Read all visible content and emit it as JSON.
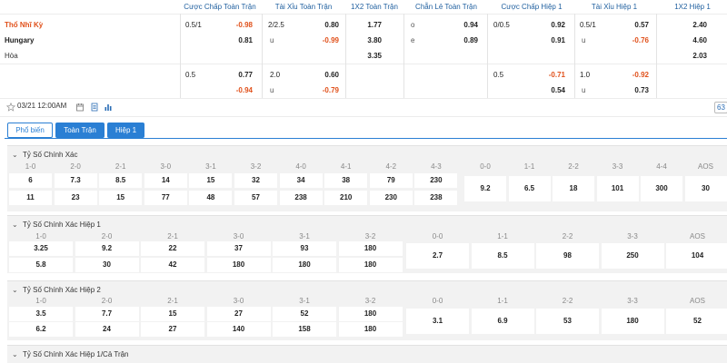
{
  "columns": [
    "Cược Chấp Toàn Trận",
    "Tài Xỉu Toàn Trận",
    "1X2 Toàn Trận",
    "Chẵn Lẻ Toàn Trận",
    "Cược Chấp Hiệp 1",
    "Tài Xỉu Hiệp 1",
    "1X2 Hiệp 1"
  ],
  "teams": {
    "home": "Thổ Nhĩ Kỳ",
    "away": "Hungary",
    "draw": "Hòa"
  },
  "row1": {
    "ah_line": "0.5/1",
    "ah_odd": "-0.98",
    "ou_line": "2/2.5",
    "ou_odd": "0.80",
    "x12": "1.77",
    "oe_label": "o",
    "oe_odd": "0.94",
    "h1_ah_line": "0/0.5",
    "h1_ah_odd": "0.92",
    "h1_ou_line": "0.5/1",
    "h1_ou_odd": "0.57",
    "h1_x12": "2.40"
  },
  "row2": {
    "ah_odd": "0.81",
    "ou_label": "u",
    "ou_odd": "-0.99",
    "x12": "3.80",
    "oe_label": "e",
    "oe_odd": "0.89",
    "h1_ah_odd": "0.91",
    "h1_ou_label": "u",
    "h1_ou_odd": "-0.76",
    "h1_x12": "4.60"
  },
  "row3": {
    "x12": "3.35",
    "h1_x12": "2.03"
  },
  "row4": {
    "ah_line": "0.5",
    "ah_odd": "0.77",
    "ou_line": "2.0",
    "ou_odd": "0.60",
    "h1_ah_line": "0.5",
    "h1_ah_odd": "-0.71",
    "h1_ou_line": "1.0",
    "h1_ou_odd": "-0.92"
  },
  "row5": {
    "ah_odd": "-0.94",
    "ou_label": "u",
    "ou_odd": "-0.79",
    "h1_ah_odd": "0.54",
    "h1_ou_label": "u",
    "h1_ou_odd": "0.73"
  },
  "toolbar": {
    "date": "03/21 12:00AM",
    "count": "63"
  },
  "tabs": [
    "Phổ biến",
    "Toàn Trận",
    "Hiệp 1"
  ],
  "sections": {
    "exact": {
      "title": "Tỷ Số Chính Xác",
      "labels": [
        "1-0",
        "2-0",
        "2-1",
        "3-0",
        "3-1",
        "3-2",
        "4-0",
        "4-1",
        "4-2",
        "4-3",
        "0-0",
        "1-1",
        "2-2",
        "3-3",
        "4-4",
        "AOS"
      ],
      "home": [
        "6",
        "7.3",
        "8.5",
        "14",
        "15",
        "32",
        "34",
        "38",
        "79",
        "230"
      ],
      "away": [
        "11",
        "23",
        "15",
        "77",
        "48",
        "57",
        "238",
        "210",
        "230",
        "238"
      ],
      "draw": [
        "9.2",
        "6.5",
        "18",
        "101",
        "300",
        "30"
      ]
    },
    "ht": {
      "title": "Tỷ Số Chính Xác Hiệp 1",
      "labels": [
        "1-0",
        "2-0",
        "2-1",
        "3-0",
        "3-1",
        "3-2",
        "0-0",
        "1-1",
        "2-2",
        "3-3",
        "AOS"
      ],
      "home": [
        "3.25",
        "9.2",
        "22",
        "37",
        "93",
        "180"
      ],
      "away": [
        "5.8",
        "30",
        "42",
        "180",
        "180",
        "180"
      ],
      "draw": [
        "2.7",
        "8.5",
        "98",
        "250",
        "104"
      ]
    },
    "h2": {
      "title": "Tỷ Số Chính Xác Hiệp 2",
      "labels": [
        "1-0",
        "2-0",
        "2-1",
        "3-0",
        "3-1",
        "3-2",
        "0-0",
        "1-1",
        "2-2",
        "3-3",
        "AOS"
      ],
      "home": [
        "3.5",
        "7.7",
        "15",
        "27",
        "52",
        "180"
      ],
      "away": [
        "6.2",
        "24",
        "27",
        "140",
        "158",
        "180"
      ],
      "draw": [
        "3.1",
        "6.9",
        "53",
        "180",
        "52"
      ]
    },
    "htft": {
      "title": "Tỷ Số Chính Xác Hiệp 1/Cả Trận"
    }
  }
}
